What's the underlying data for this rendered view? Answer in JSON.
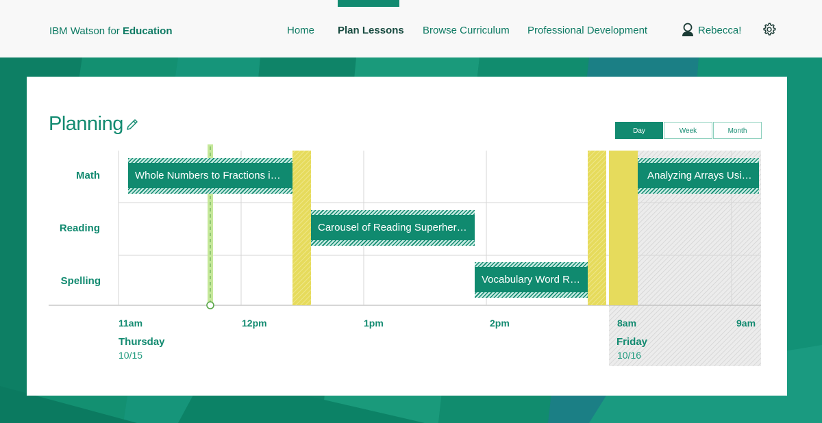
{
  "header": {
    "brand_prefix": "IBM Watson for ",
    "brand_bold": "Education",
    "nav": [
      {
        "label": "Home"
      },
      {
        "label": "Plan Lessons",
        "active": true
      },
      {
        "label": "Browse Curriculum"
      },
      {
        "label": "Professional Development"
      }
    ],
    "user_name": "Rebecca!",
    "user_icon": "user-icon",
    "settings_icon": "gear-icon"
  },
  "planning": {
    "title": "Planning",
    "edit_icon": "pencil-icon",
    "view_options": [
      {
        "label": "Day",
        "selected": true
      },
      {
        "label": "Week"
      },
      {
        "label": "Month"
      }
    ],
    "subjects": [
      "Math",
      "Reading",
      "Spelling"
    ],
    "time_labels": [
      "11am",
      "12pm",
      "1pm",
      "2pm",
      "8am",
      "9am"
    ],
    "days": [
      {
        "name": "Thursday",
        "date": "10/15"
      },
      {
        "name": "Friday",
        "date": "10/16"
      }
    ],
    "events": [
      {
        "subject": "Math",
        "title": "Whole Numbers to Fractions in Gr..."
      },
      {
        "subject": "Reading",
        "title": "Carousel of Reading Superheroes"
      },
      {
        "subject": "Spelling",
        "title": "Vocabulary Word Rev..."
      },
      {
        "subject": "Math",
        "title": "Analyzing Arrays Using..."
      }
    ]
  },
  "colors": {
    "brand_green": "#128a70",
    "event_green": "#108a6f",
    "break_yellow": "#e6db5c",
    "now_marker": "#9bd66a",
    "background_green": "#0f8a6c"
  }
}
